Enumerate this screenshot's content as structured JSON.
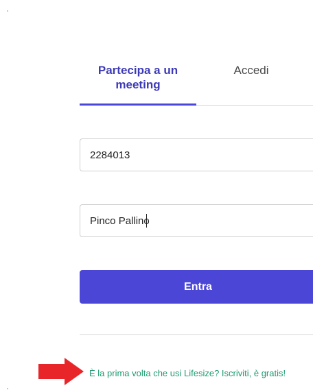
{
  "tabs": {
    "join_label": "Partecipa a un meeting",
    "login_label": "Accedi"
  },
  "form": {
    "meeting_id_value": "2284013",
    "name_value": "Pinco Pallino",
    "enter_label": "Entra"
  },
  "signup": {
    "text": "È la prima volta che usi Lifesize? Iscriviti, è gratis!"
  },
  "annotation": {
    "arrow_icon": "red-arrow-right-icon",
    "arrow_color": "#e8262a"
  },
  "colors": {
    "accent": "#4b46d6",
    "link": "#1f9a70"
  }
}
